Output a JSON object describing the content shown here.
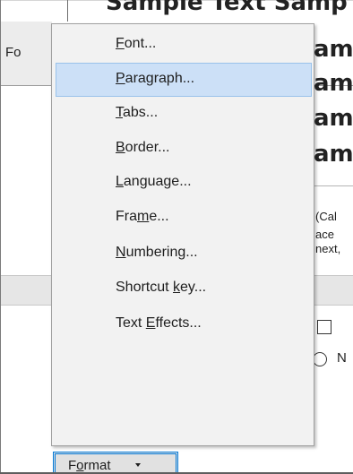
{
  "background": {
    "sample_top": "Sample Text Samp",
    "sample_lines": [
      "amp",
      "amp",
      "amp",
      "amp"
    ],
    "left_tab_label": "Fo",
    "description_lines": [
      "(Cal",
      "ace",
      "next,"
    ],
    "radio_label": "N"
  },
  "menu": {
    "items": [
      {
        "label": "Font...",
        "mnemonic": "F",
        "highlighted": false
      },
      {
        "label": "Paragraph...",
        "mnemonic": "P",
        "highlighted": true
      },
      {
        "label": "Tabs...",
        "mnemonic": "T",
        "highlighted": false
      },
      {
        "label": "Border...",
        "mnemonic": "B",
        "highlighted": false
      },
      {
        "label": "Language...",
        "mnemonic": "L",
        "highlighted": false
      },
      {
        "label": "Frame...",
        "mnemonic": "m",
        "highlighted": false
      },
      {
        "label": "Numbering...",
        "mnemonic": "N",
        "highlighted": false
      },
      {
        "label": "Shortcut key...",
        "mnemonic": "k",
        "highlighted": false
      },
      {
        "label": "Text Effects...",
        "mnemonic": "E",
        "highlighted": false
      }
    ]
  },
  "format_button": {
    "label": "Format",
    "mnemonic": "o"
  },
  "colors": {
    "menu_bg": "#f2f2f2",
    "highlight_bg": "#cce0f7",
    "highlight_border": "#99c2eb",
    "focus_border": "#0078d7"
  }
}
